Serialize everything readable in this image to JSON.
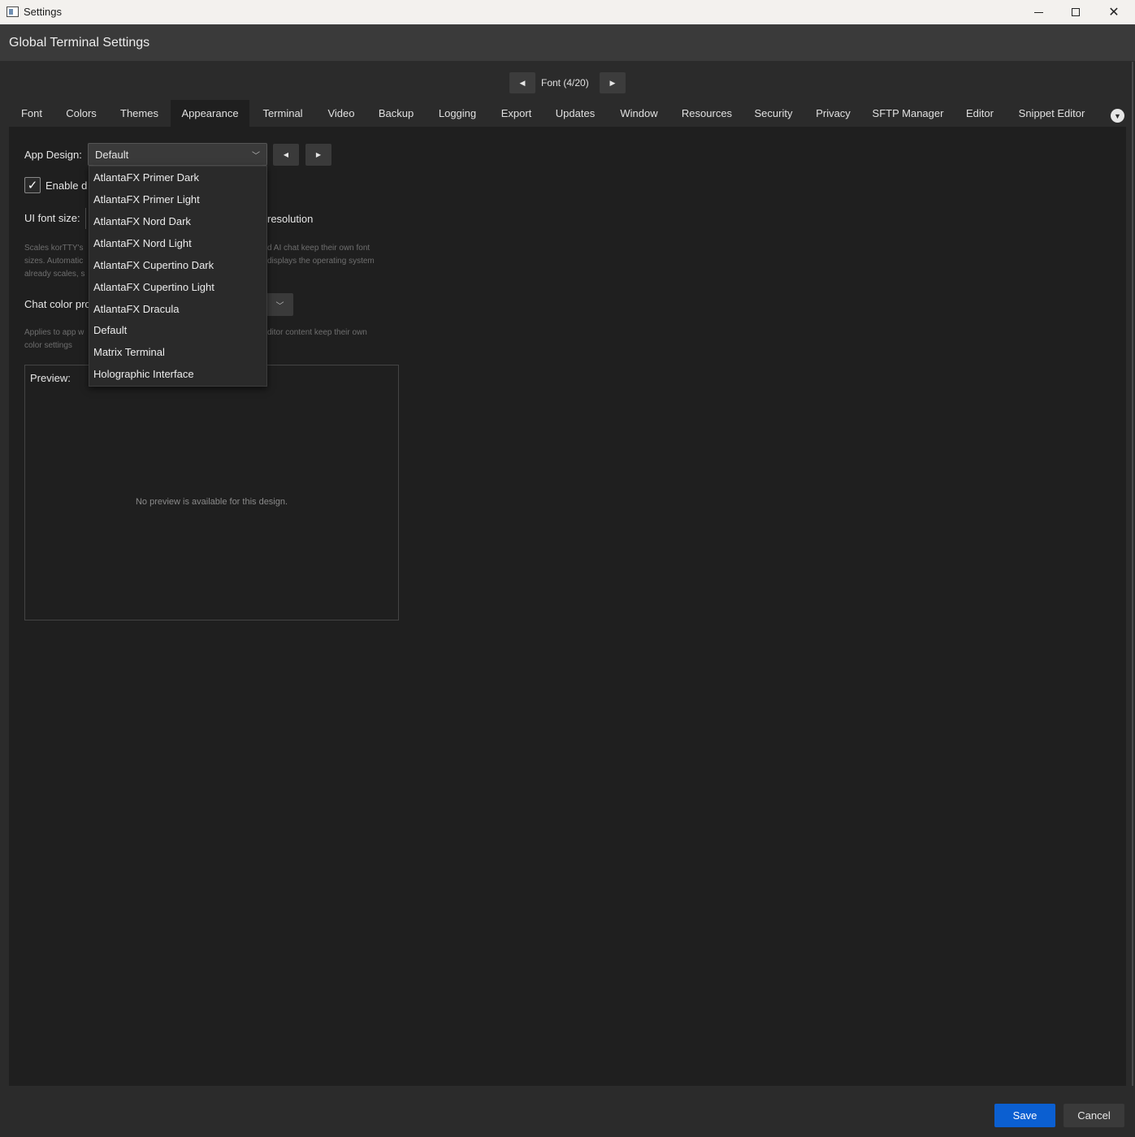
{
  "window": {
    "title": "Settings"
  },
  "header": {
    "title": "Global Terminal Settings"
  },
  "nav": {
    "label": "Font  (4/20)",
    "prev_icon": "triangle-left-icon",
    "next_icon": "triangle-right-icon"
  },
  "tabs": [
    {
      "label": "Font"
    },
    {
      "label": "Colors"
    },
    {
      "label": "Themes"
    },
    {
      "label": "Appearance",
      "active": true
    },
    {
      "label": "Terminal"
    },
    {
      "label": "Video"
    },
    {
      "label": "Backup"
    },
    {
      "label": "Logging"
    },
    {
      "label": "Export"
    },
    {
      "label": "Updates"
    },
    {
      "label": "Window"
    },
    {
      "label": "Resources"
    },
    {
      "label": "Security"
    },
    {
      "label": "Privacy"
    },
    {
      "label": "SFTP Manager"
    },
    {
      "label": "Editor"
    },
    {
      "label": "Snippet Editor"
    }
  ],
  "appearance": {
    "app_design_label": "App Design:",
    "app_design_value": "Default",
    "enable_label_visible": "Enable d",
    "enable_checked": true,
    "font_size_label": "UI font size:",
    "resolution_fragment": "resolution",
    "font_desc_line1_left": "Scales korTTY's",
    "font_desc_line1_right": "d AI chat keep their own font",
    "font_desc_line2_left": "sizes. Automatic",
    "font_desc_line2_right": "displays the operating system",
    "font_desc_line3_left": "already scales, s",
    "chat_color_label": "Chat color pro",
    "chat_desc_line1_left": "Applies to app w",
    "chat_desc_line1_right": "ditor content keep their own",
    "chat_desc_line2_left": "color settings",
    "preview_label": "Preview:",
    "preview_empty": "No preview is available for this design."
  },
  "dropdown": {
    "options": [
      "AtlantaFX Primer Dark",
      "AtlantaFX Primer Light",
      "AtlantaFX Nord Dark",
      "AtlantaFX Nord Light",
      "AtlantaFX Cupertino Dark",
      "AtlantaFX Cupertino Light",
      "AtlantaFX Dracula",
      "Default",
      "Matrix Terminal",
      "Holographic Interface"
    ]
  },
  "footer": {
    "save": "Save",
    "cancel": "Cancel"
  },
  "colors": {
    "accent": "#0b5fd1",
    "background": "#1f1f1f",
    "panel": "#2b2b2b"
  }
}
